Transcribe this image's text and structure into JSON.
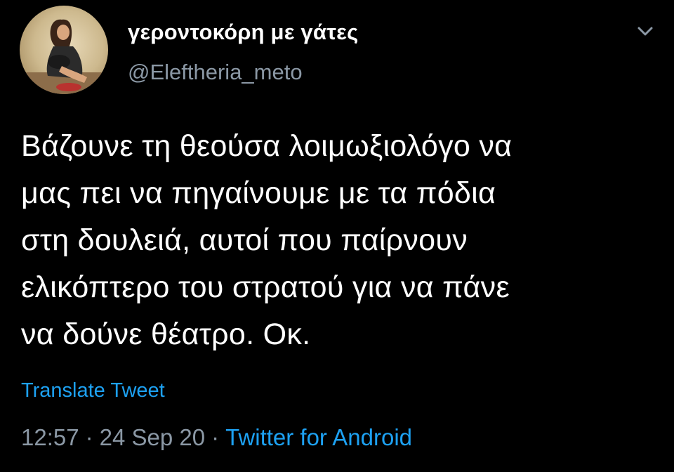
{
  "author": {
    "display_name": "γεροντοκόρη με γάτες",
    "handle": "@Eleftheria_meto",
    "avatar_icon": "profile-photo"
  },
  "tweet": {
    "text": "Βάζουνε τη θεούσα λοιμωξιολόγο να\nμας πει να πηγαίνουμε με τα πόδια\nστη δουλειά, αυτοί που παίρνουν\nελικόπτερο του στρατού για να πάνε\nνα δούνε θέατρο. Οκ.",
    "translate_label": "Translate Tweet",
    "time": "12:57",
    "date": "24 Sep 20",
    "separator": "·",
    "source": "Twitter for Android"
  },
  "menu": {
    "icon": "chevron-down-icon"
  },
  "colors": {
    "background": "#000000",
    "text": "#ffffff",
    "secondary": "#8b98a5",
    "link": "#1da1f2"
  }
}
